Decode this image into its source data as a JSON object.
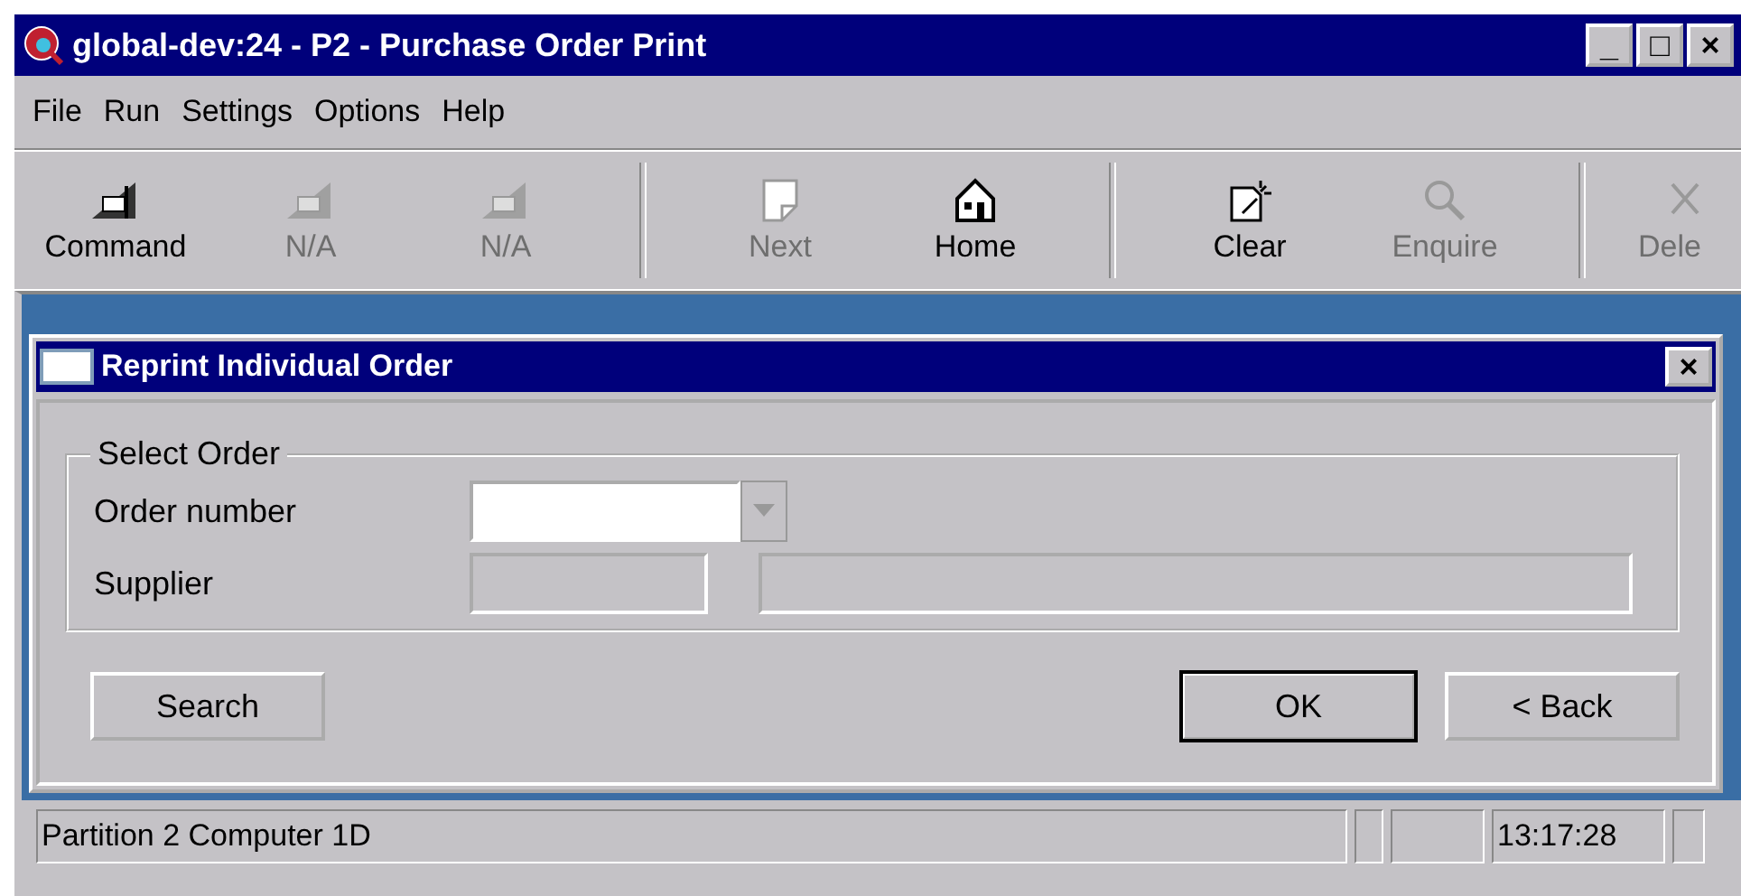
{
  "window": {
    "title": "global-dev:24 - P2 - Purchase Order Print",
    "controls": [
      "_",
      "□",
      "×"
    ]
  },
  "menu": [
    "File",
    "Run",
    "Settings",
    "Options",
    "Help"
  ],
  "toolbar": [
    {
      "kind": "button",
      "label": "Command",
      "disabled": false
    },
    {
      "kind": "button",
      "label": "N/A",
      "disabled": true
    },
    {
      "kind": "button",
      "label": "N/A",
      "disabled": true
    },
    {
      "kind": "separator"
    },
    {
      "kind": "button",
      "label": "Next",
      "disabled": true
    },
    {
      "kind": "button",
      "label": "Home",
      "disabled": false
    },
    {
      "kind": "separator"
    },
    {
      "kind": "button",
      "label": "Clear",
      "disabled": false
    },
    {
      "kind": "button",
      "label": "Enquire",
      "disabled": true
    },
    {
      "kind": "separator"
    },
    {
      "kind": "button",
      "label": "Dele",
      "disabled": true
    }
  ],
  "dialog": {
    "title": "Reprint Individual Order",
    "close": "×",
    "group": {
      "title": "Select Order",
      "fields": [
        {
          "label": "Order number",
          "kind": "combo",
          "disabled": false
        },
        {
          "label": "Supplier",
          "kind": "pair",
          "disabled": true
        }
      ]
    },
    "buttons": [
      {
        "label": "Search",
        "default": false
      },
      {
        "label": "OK",
        "default": true
      },
      {
        "label": "< Back",
        "default": false
      }
    ]
  },
  "status_bar": {
    "message": "Partition 2 Computer 1D",
    "clock": "13:17:28"
  }
}
